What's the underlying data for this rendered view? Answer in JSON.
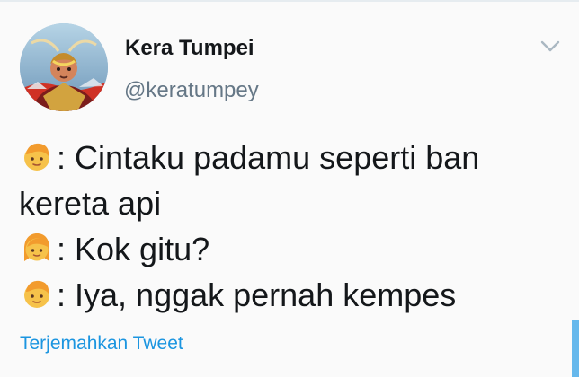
{
  "profile": {
    "display_name": "Kera Tumpei",
    "username": "@keratumpey",
    "avatar_icon": "monkey-king-avatar"
  },
  "menu": {
    "icon": "chevron-down-icon"
  },
  "tweet": {
    "lines": [
      {
        "speaker_icon": "boy-emoji-icon",
        "separator": ":",
        "text": " Cintaku padamu seperti ban kereta api"
      },
      {
        "speaker_icon": "woman-emoji-icon",
        "separator": ":",
        "text": " Kok gitu?"
      },
      {
        "speaker_icon": "boy-emoji-icon",
        "separator": ":",
        "text": " Iya, nggak pernah kempes"
      }
    ]
  },
  "actions": {
    "translate_label": "Terjemahkan Tweet"
  },
  "colors": {
    "background": "#fafafa",
    "primary_text": "#14171a",
    "secondary_text": "#657786",
    "link": "#1b95e0",
    "emoji_skin": "#f6c24a",
    "emoji_hair": "#f29b2d"
  }
}
